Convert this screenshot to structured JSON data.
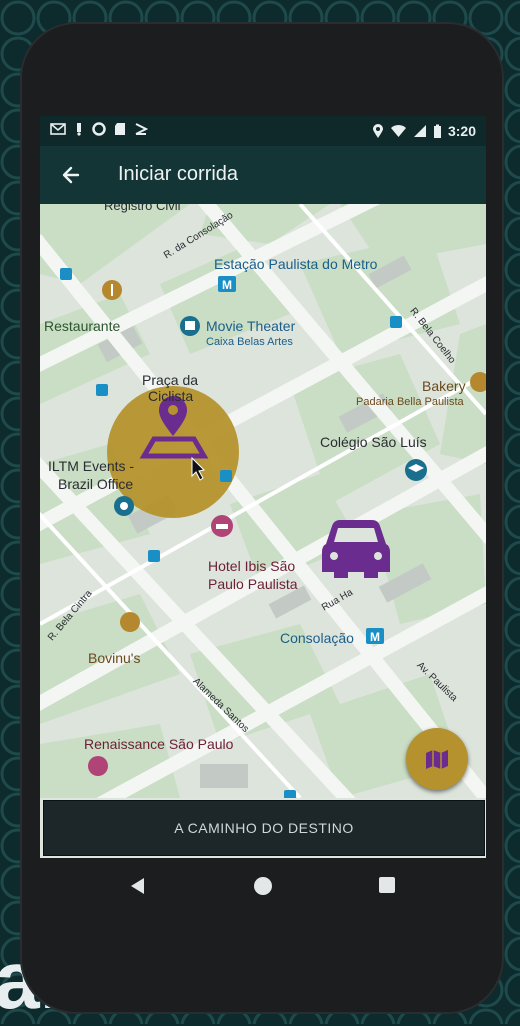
{
  "status_bar": {
    "time": "3:20",
    "left_icons": [
      "gmail-icon",
      "notification-icon",
      "circle-icon",
      "sd-card-icon",
      "download-icon"
    ],
    "right_icons": [
      "location-icon",
      "wifi-icon",
      "signal-icon",
      "battery-icon"
    ]
  },
  "app_bar": {
    "title": "Iniciar corrida",
    "back_icon": "arrow-back-icon"
  },
  "map": {
    "labels": {
      "registro_civil": "Registro Civil",
      "r_consolacao": "R. da Consolação",
      "estacao": "Estação Paulista do Metro",
      "restaurante": "Restaurante",
      "movie_theater": "Movie Theater",
      "caixa_belas_artes": "Caixa Belas Artes",
      "r_bela_coelho": "R. Bela Coelho",
      "praca_line1": "Praça da",
      "praca_line2": "Ciclista",
      "bakery": "Bakery",
      "padaria": "Padaria Bella Paulista",
      "colegio": "Colégio São Luís",
      "iltm_line1": "ILTM Events -",
      "iltm_line2": "Brazil Office",
      "hotel_line1": "Hotel Ibis São",
      "hotel_line2": "Paulo Paulista",
      "consolacao": "Consolação",
      "r_bela_cintra": "R. Bela Cintra",
      "rua_haddock": "Rua Ha",
      "bovinus": "Bovinu's",
      "alameda_santos": "Alameda Santos",
      "av_paulista": "Av. Paulista",
      "renaissance": "Renaissance São Paulo",
      "metro_sign": "M"
    },
    "destination_marker": "map-pin-icon",
    "vehicle_marker": "car-icon",
    "fab_icon": "map-icon",
    "colors": {
      "destination_circle": "#b5922d",
      "marker_purple": "#6a2c8e",
      "map_base": "#dfe6de",
      "park_green": "#c7e0c2"
    }
  },
  "bottom_button": {
    "label": "A CAMINHO DO DESTINO"
  },
  "nav_bar": {
    "back": "triangle-back-icon",
    "home": "circle-home-icon",
    "recents": "square-recents-icon"
  },
  "background": {
    "letter": "a."
  }
}
